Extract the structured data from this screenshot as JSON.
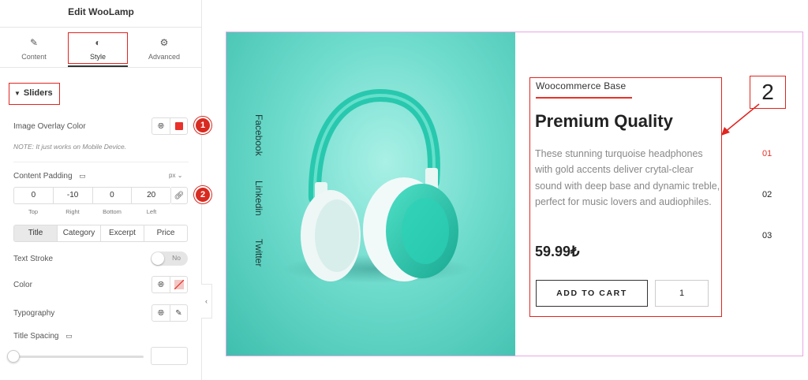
{
  "panel": {
    "title": "Edit WooLamp",
    "tabs": [
      {
        "label": "Content",
        "icon": "pencil-icon"
      },
      {
        "label": "Style",
        "icon": "half-circle-icon"
      },
      {
        "label": "Advanced",
        "icon": "gear-icon"
      }
    ],
    "active_tab": "Style",
    "section_title": "Sliders",
    "image_overlay_label": "Image Overlay Color",
    "overlay_color": "#e8312a",
    "note": "NOTE: It just works on Mobile Device.",
    "content_padding_label": "Content Padding",
    "padding_unit": "px",
    "padding": {
      "top": "0",
      "right": "-10",
      "bottom": "0",
      "left": "20"
    },
    "padding_labels": {
      "top": "Top",
      "right": "Right",
      "bottom": "Bottom",
      "left": "Left"
    },
    "segments": [
      "Title",
      "Category",
      "Excerpt",
      "Price"
    ],
    "active_segment": "Title",
    "text_stroke_label": "Text Stroke",
    "text_stroke_value": "No",
    "color_label": "Color",
    "typography_label": "Typography",
    "title_spacing_label": "Title Spacing",
    "badges": [
      "1",
      "2"
    ]
  },
  "preview": {
    "social_links": [
      "Facebook",
      "Linkedin",
      "Twitter"
    ],
    "category": "Woocommerce Base",
    "title": "Premium Quality",
    "description": "These stunning turquoise headphones with gold accents deliver crytal-clear sound with deep base and dynamic treble, perfect for music lovers and audiophiles.",
    "price": "59.99₺",
    "add_to_cart": "ADD TO CART",
    "quantity": "1",
    "pager": [
      "01",
      "02",
      "03"
    ],
    "active_page": "01",
    "annotation": "2",
    "accent_color": "#e8312a"
  }
}
